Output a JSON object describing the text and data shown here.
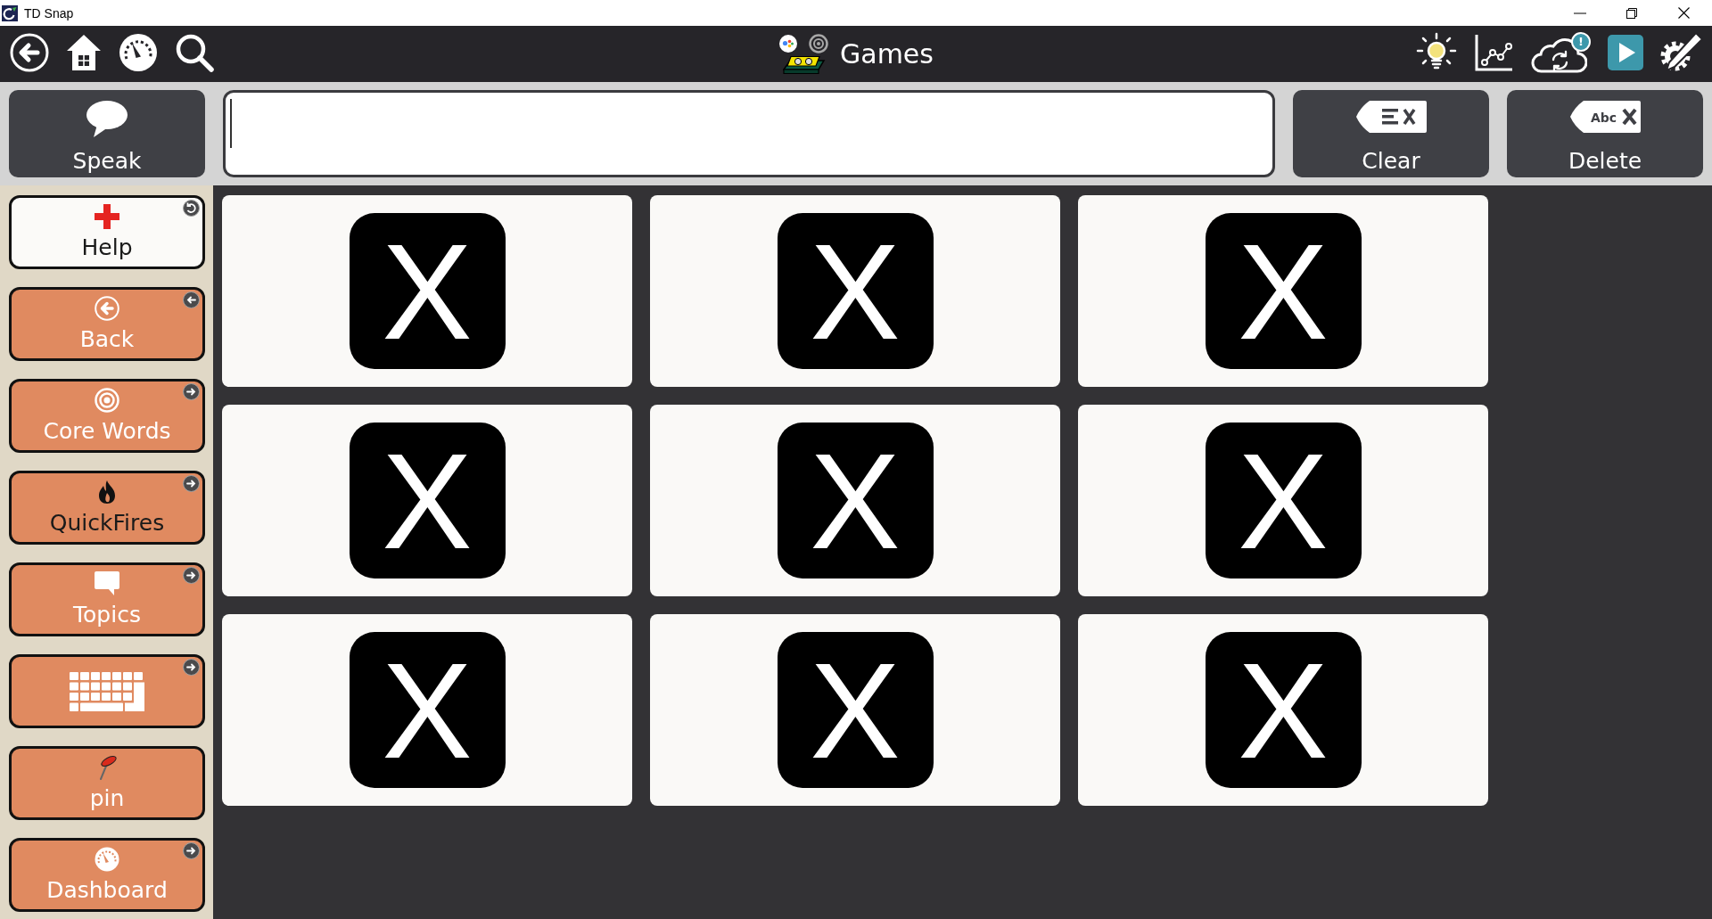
{
  "window": {
    "title": "TD Snap"
  },
  "toolbar": {
    "title": "Games",
    "sync_alert": "!"
  },
  "message_bar": {
    "speak": {
      "label": "Speak"
    },
    "message_field": {
      "focused": true
    },
    "clear": {
      "label": "Clear"
    },
    "delete": {
      "label": "Delete",
      "icon_text": "Abc"
    }
  },
  "sidebar": {
    "items": [
      {
        "label": "Help",
        "color": "#fbfaf8",
        "dark_label": true,
        "badge": {
          "kind": "return"
        }
      },
      {
        "label": "Back",
        "color": "#e08a60",
        "dark_label": false,
        "badge": {
          "kind": "back"
        }
      },
      {
        "label": "Core Words",
        "color": "#e08a60",
        "dark_label": false,
        "badge": {
          "kind": "link"
        }
      },
      {
        "label": "QuickFires",
        "color": "#e08a60",
        "dark_label": true,
        "badge": {
          "kind": "link"
        }
      },
      {
        "label": "Topics",
        "color": "#e08a60",
        "dark_label": false,
        "badge": {
          "kind": "link"
        }
      },
      {
        "color": "#e08a60",
        "badge": {
          "kind": "link"
        }
      },
      {
        "label": "pin",
        "color": "#e08a60",
        "dark_label": false
      },
      {
        "label": "Dashboard",
        "color": "#e08a60",
        "dark_label": false,
        "badge": {
          "kind": "link"
        }
      }
    ]
  },
  "grid": {
    "tiles": [
      {
        "symbol": "X"
      },
      {
        "symbol": "X"
      },
      {
        "symbol": "X"
      },
      {
        "symbol": "X"
      },
      {
        "symbol": "X"
      },
      {
        "symbol": "X"
      },
      {
        "symbol": "X"
      },
      {
        "symbol": "X"
      },
      {
        "symbol": "X"
      }
    ]
  }
}
